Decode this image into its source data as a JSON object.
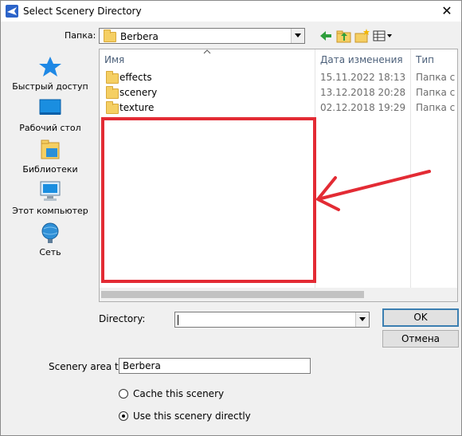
{
  "window": {
    "title": "Select Scenery Directory",
    "close_glyph": "✕"
  },
  "toolbar": {
    "lookin_label": "Папка:",
    "current_folder": "Berbera",
    "icons": [
      "back-icon",
      "up-folder-icon",
      "new-folder-icon",
      "view-menu-icon"
    ]
  },
  "places": [
    {
      "label": "Быстрый доступ",
      "icon": "quick-access-icon"
    },
    {
      "label": "Рабочий стол",
      "icon": "desktop-icon"
    },
    {
      "label": "Библиотеки",
      "icon": "libraries-icon"
    },
    {
      "label": "Этот компьютер",
      "icon": "computer-icon"
    },
    {
      "label": "Сеть",
      "icon": "network-icon"
    }
  ],
  "filelist": {
    "columns": [
      "Имя",
      "Дата изменения",
      "Тип"
    ],
    "rows": [
      {
        "name": "effects",
        "date": "15.11.2022 18:13",
        "type": "Папка с ф"
      },
      {
        "name": "scenery",
        "date": "13.12.2018 20:28",
        "type": "Папка с ф"
      },
      {
        "name": "texture",
        "date": "02.12.2018 19:29",
        "type": "Папка с ф"
      }
    ]
  },
  "directory": {
    "label": "Directory:",
    "value": ""
  },
  "buttons": {
    "ok": "OK",
    "cancel": "Отмена"
  },
  "scenery_title": {
    "label": "Scenery area title:",
    "value": "Berbera"
  },
  "options": {
    "cache": "Cache this scenery",
    "direct": "Use this scenery directly",
    "selected": "direct"
  },
  "colors": {
    "annotation": "#e32b34",
    "accent": "#3c7fb1",
    "folder": "#f5cf63"
  }
}
